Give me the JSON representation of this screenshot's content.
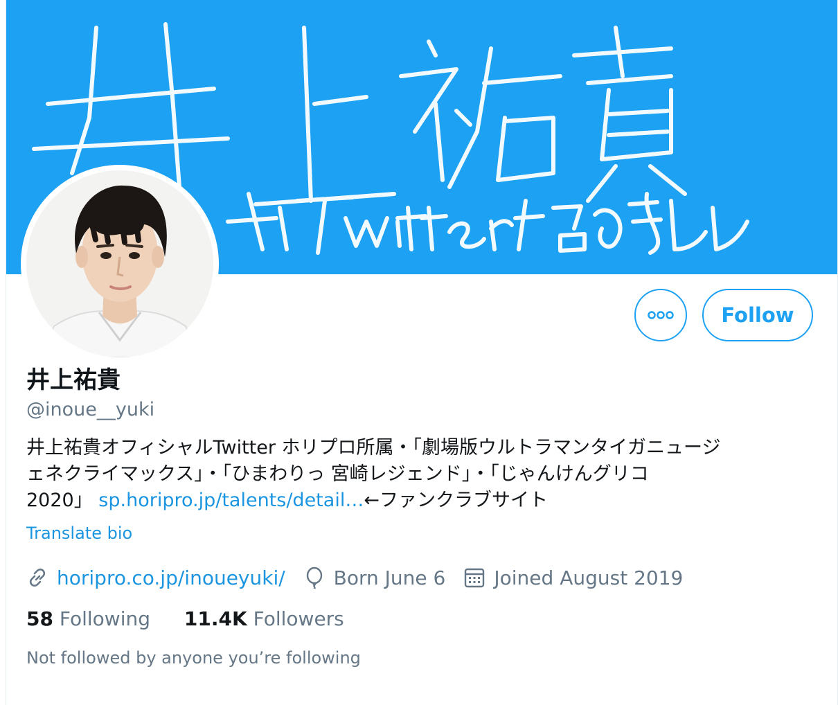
{
  "banner": {
    "title_text": "井上祐貴",
    "subtitle_text": "公式Twitter始めました",
    "background_color": "#1da1f2"
  },
  "profile": {
    "display_name": "井上祐貴",
    "handle": "@inoue__yuki",
    "avatar": "profile-photo"
  },
  "actions": {
    "more_icon": "more-options-icon",
    "follow_label": "Follow"
  },
  "bio": {
    "line1": "井上祐貴オフィシャルTwitter ホリプロ所属・「劇場版ウルトラマンタイガニュージ",
    "line2": "ェネクライマックス」・「ひまわりっ 宮崎レジェンド」・「じゃんけんグリコ",
    "line3_prefix": "2020」 ",
    "line3_link": "sp.horipro.jp/talents/detail…",
    "line3_suffix": "←ファンクラブサイト",
    "translate_label": "Translate bio"
  },
  "meta": {
    "website_icon": "link-icon",
    "website": "horipro.co.jp/inoueyuki/",
    "birthday_icon": "balloon-icon",
    "birthday": "Born June 6",
    "joined_icon": "calendar-icon",
    "joined": "Joined August 2019"
  },
  "stats": {
    "following_count": "58",
    "following_label": "Following",
    "followers_count": "11.4K",
    "followers_label": "Followers"
  },
  "social_context": "Not followed by anyone you’re following",
  "colors": {
    "accent": "#1da1f2",
    "link": "#1b95e0",
    "secondary_text": "#657786"
  }
}
